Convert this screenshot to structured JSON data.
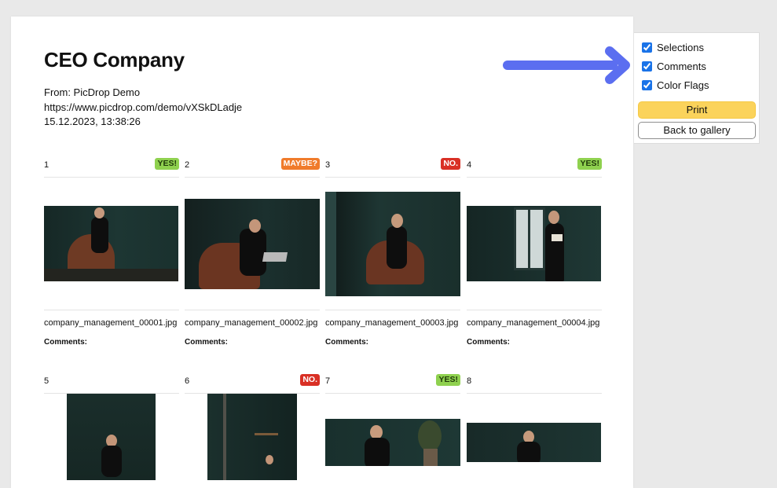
{
  "header": {
    "title": "CEO Company",
    "from": "From: PicDrop Demo",
    "url": "https://www.picdrop.com/demo/vXSkDLadje",
    "datetime": "15.12.2023, 13:38:26"
  },
  "panel": {
    "options": [
      {
        "label": "Selections",
        "checked": true
      },
      {
        "label": "Comments",
        "checked": true
      },
      {
        "label": "Color Flags",
        "checked": true
      }
    ],
    "print_label": "Print",
    "back_label": "Back to gallery"
  },
  "colors": {
    "accent_arrow": "#5b6ef0",
    "print_button": "#fbd35b",
    "yes": "#8fd14f",
    "maybe": "#f07b2b",
    "no": "#d93025"
  },
  "images": [
    {
      "number": "1",
      "badge": "YES!",
      "badge_type": "yes",
      "filename": "company_management_00001.jpg",
      "comments_label": "Comments:"
    },
    {
      "number": "2",
      "badge": "MAYBE?",
      "badge_type": "maybe",
      "filename": "company_management_00002.jpg",
      "comments_label": "Comments:"
    },
    {
      "number": "3",
      "badge": "NO.",
      "badge_type": "no",
      "filename": "company_management_00003.jpg",
      "comments_label": "Comments:"
    },
    {
      "number": "4",
      "badge": "YES!",
      "badge_type": "yes",
      "filename": "company_management_00004.jpg",
      "comments_label": "Comments:"
    },
    {
      "number": "5",
      "badge": "",
      "badge_type": "",
      "filename": "",
      "comments_label": ""
    },
    {
      "number": "6",
      "badge": "NO.",
      "badge_type": "no",
      "filename": "",
      "comments_label": ""
    },
    {
      "number": "7",
      "badge": "YES!",
      "badge_type": "yes",
      "filename": "",
      "comments_label": ""
    },
    {
      "number": "8",
      "badge": "",
      "badge_type": "",
      "filename": "",
      "comments_label": ""
    }
  ]
}
